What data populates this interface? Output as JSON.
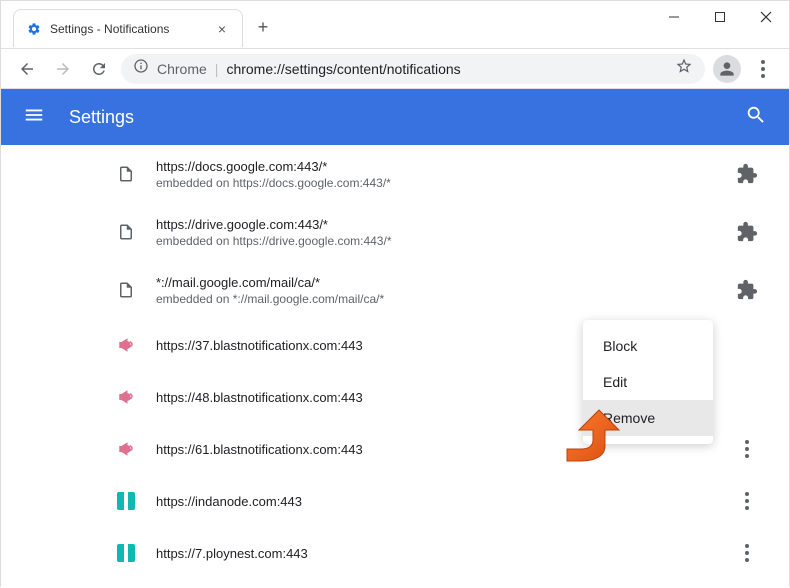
{
  "window": {
    "tab_title": "Settings - Notifications"
  },
  "address": {
    "prefix": "Chrome",
    "url": "chrome://settings/content/notifications"
  },
  "header": {
    "title": "Settings"
  },
  "sites": {
    "items": [
      {
        "url": "https://docs.google.com:443/*",
        "sub": "embedded on https://docs.google.com:443/*",
        "icon": "doc"
      },
      {
        "url": "https://drive.google.com:443/*",
        "sub": "embedded on https://drive.google.com:443/*",
        "icon": "doc"
      },
      {
        "url": "*://mail.google.com/mail/ca/*",
        "sub": "embedded on *://mail.google.com/mail/ca/*",
        "icon": "doc"
      },
      {
        "url": "https://37.blastnotificationx.com:443",
        "icon": "speaker"
      },
      {
        "url": "https://48.blastnotificationx.com:443",
        "icon": "speaker"
      },
      {
        "url": "https://61.blastnotificationx.com:443",
        "icon": "speaker"
      },
      {
        "url": "https://indanode.com:443",
        "icon": "teal"
      },
      {
        "url": "https://7.ploynest.com:443",
        "icon": "teal"
      }
    ]
  },
  "context_menu": {
    "block": "Block",
    "edit": "Edit",
    "remove": "Remove"
  }
}
